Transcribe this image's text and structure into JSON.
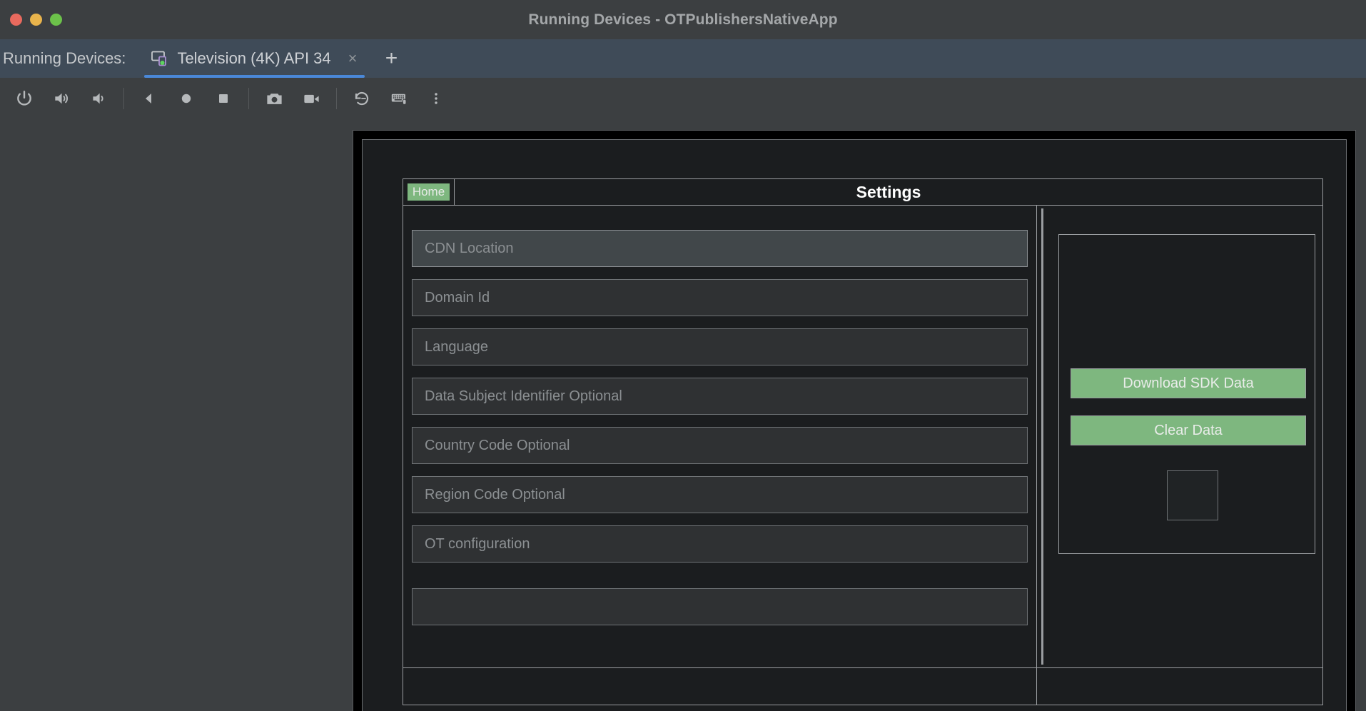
{
  "window": {
    "title": "Running Devices - OTPublishersNativeApp",
    "traffic_lights": [
      {
        "name": "close",
        "color": "#e96a5e"
      },
      {
        "name": "minimize",
        "color": "#e9b44c"
      },
      {
        "name": "maximize",
        "color": "#6cc24a"
      }
    ]
  },
  "tabstrip": {
    "label": "Running Devices:",
    "tabs": [
      {
        "name": "Television (4K) API 34",
        "icon": "device-screen-icon",
        "close": "×",
        "active": true
      }
    ],
    "add_tab": "+"
  },
  "toolbar": {
    "buttons": [
      {
        "name": "power-icon",
        "tooltip": "Power"
      },
      {
        "name": "volume-up-icon",
        "tooltip": "Volume Up"
      },
      {
        "name": "volume-down-icon",
        "tooltip": "Volume Down"
      },
      {
        "name": "back-icon",
        "tooltip": "Back"
      },
      {
        "name": "home-icon",
        "tooltip": "Home"
      },
      {
        "name": "overview-icon",
        "tooltip": "Overview"
      },
      {
        "name": "screenshot-camera-icon",
        "tooltip": "Take Screenshot"
      },
      {
        "name": "record-video-icon",
        "tooltip": "Record Screen"
      },
      {
        "name": "rotate-left-icon",
        "tooltip": "Rotate Left"
      },
      {
        "name": "keyboard-icon",
        "tooltip": "Hardware Input"
      },
      {
        "name": "more-vertical-icon",
        "tooltip": "More"
      }
    ]
  },
  "app": {
    "home_tab_label": "Home",
    "title": "Settings",
    "fields": [
      {
        "placeholder": "CDN Location",
        "value": "",
        "focused": true
      },
      {
        "placeholder": "Domain Id",
        "value": "",
        "focused": false
      },
      {
        "placeholder": "Language",
        "value": "",
        "focused": false
      },
      {
        "placeholder": "Data Subject Identifier Optional",
        "value": "",
        "focused": false
      },
      {
        "placeholder": "Country Code Optional",
        "value": "",
        "focused": false
      },
      {
        "placeholder": "Region Code Optional",
        "value": "",
        "focused": false
      },
      {
        "placeholder": "OT configuration",
        "value": "",
        "focused": false
      },
      {
        "placeholder": "",
        "value": "",
        "focused": false
      }
    ],
    "actions": [
      {
        "label": "Download SDK Data"
      },
      {
        "label": "Clear Data"
      }
    ],
    "image_placeholder": ""
  },
  "colors": {
    "accent_green": "#7eb77f",
    "tab_underline": "#4a88d8",
    "tabstrip_bg": "#3f4b58",
    "chrome_bg": "#3c3f41",
    "device_screen_bg": "#1b1d1f",
    "field_border": "#6f7376",
    "outline": "#9a9da0"
  }
}
